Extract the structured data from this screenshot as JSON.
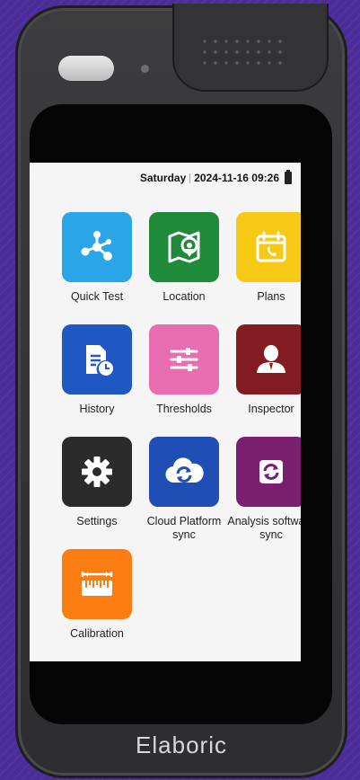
{
  "status": {
    "day": "Saturday",
    "datetime": "2024-11-16 09:26"
  },
  "apps": [
    {
      "label": "Quick Test",
      "icon": "network-icon",
      "color": "#2aa6e8"
    },
    {
      "label": "Location",
      "icon": "map-pin-icon",
      "color": "#1e8a3a"
    },
    {
      "label": "Plans",
      "icon": "calendar-icon",
      "color": "#f6c915"
    },
    {
      "label": "History",
      "icon": "document-clock-icon",
      "color": "#1f57c3"
    },
    {
      "label": "Thresholds",
      "icon": "sliders-icon",
      "color": "#e96eb1"
    },
    {
      "label": "Inspector",
      "icon": "person-icon",
      "color": "#821c22"
    },
    {
      "label": "Settings",
      "icon": "gear-icon",
      "color": "#2b2b2b"
    },
    {
      "label": "Cloud Platform sync",
      "icon": "cloud-sync-icon",
      "color": "#1f4fb4"
    },
    {
      "label": "Analysis software sync",
      "icon": "sync-icon",
      "color": "#7a1f6f"
    },
    {
      "label": "Calibration",
      "icon": "ruler-icon",
      "color": "#fb7d12"
    }
  ],
  "brand": "Elaboric"
}
